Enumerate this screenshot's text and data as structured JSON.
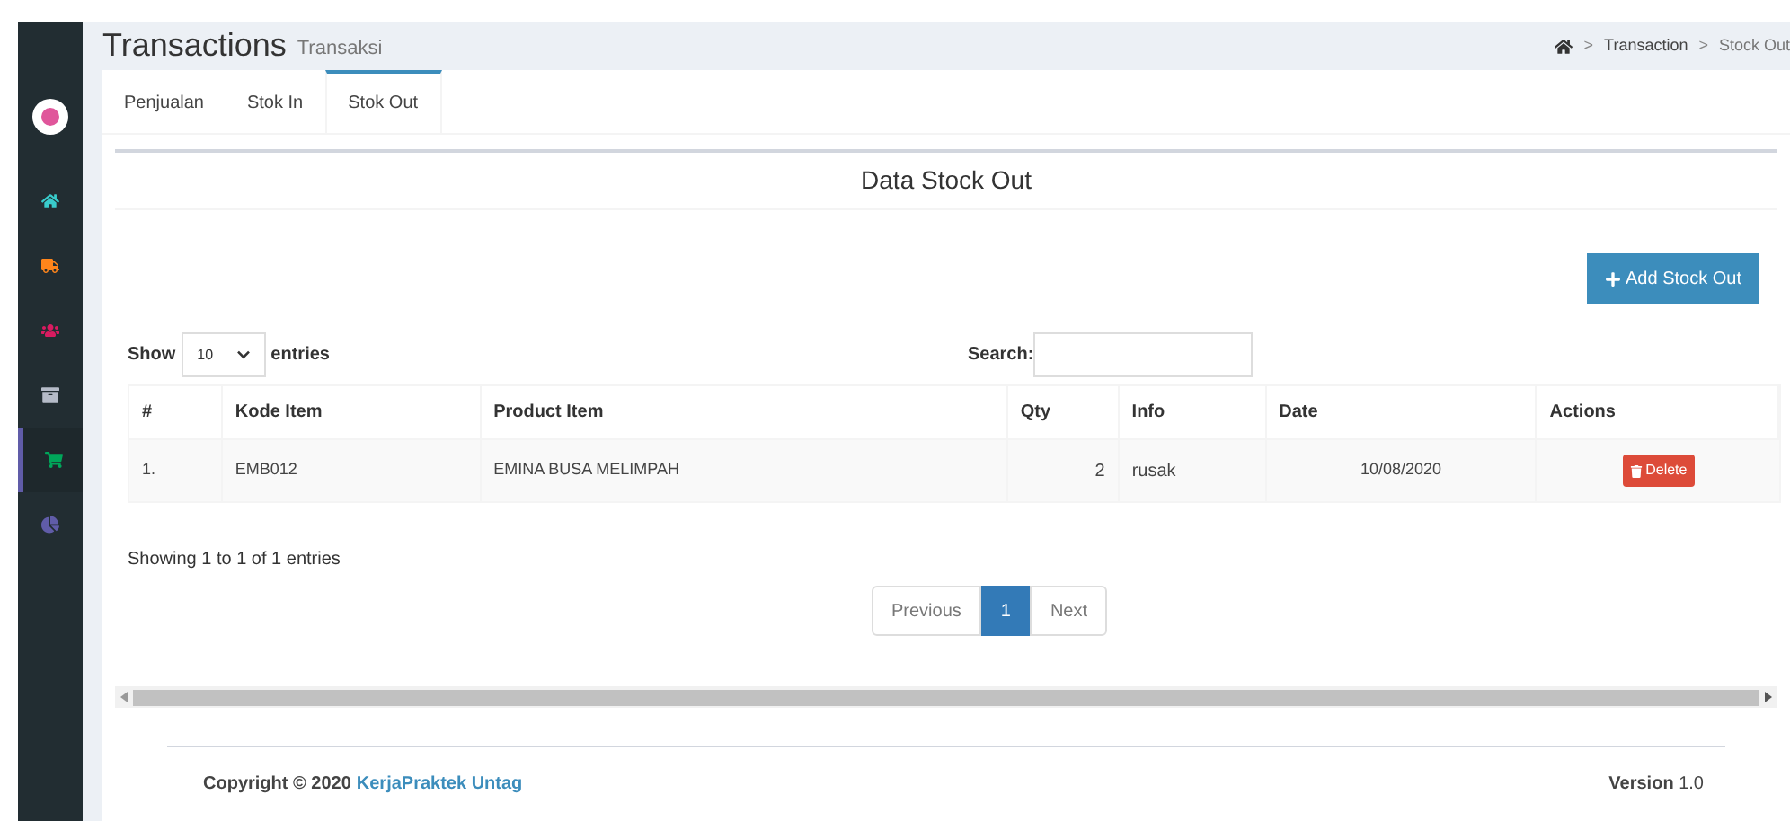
{
  "sidebar": {
    "items": [
      {
        "kind": "home",
        "color": "#39cccc",
        "selected": false
      },
      {
        "kind": "truck",
        "color": "#ff851b",
        "selected": false
      },
      {
        "kind": "users",
        "color": "#d81b60",
        "selected": false
      },
      {
        "kind": "archive",
        "color": "#b5bbc8",
        "selected": false
      },
      {
        "kind": "cart",
        "color": "#00a65a",
        "selected": true
      },
      {
        "kind": "chart",
        "color": "#605ca8",
        "selected": false
      }
    ]
  },
  "header": {
    "title": "Transactions",
    "subtitle": "Transaksi",
    "breadcrumb": [
      "Transaction",
      "Stock Out"
    ],
    "separator": ">"
  },
  "tabs": [
    {
      "label": "Penjualan",
      "selected": false
    },
    {
      "label": "Stok In",
      "selected": false
    },
    {
      "label": "Stok Out",
      "selected": true
    }
  ],
  "panel": {
    "title": "Data Stock Out",
    "add_button": "Add Stock Out",
    "length": {
      "before": "Show",
      "value": "10",
      "after": "entries"
    },
    "search": {
      "label": "Search:"
    },
    "table": {
      "columns": [
        "#",
        "Kode Item",
        "Product Item",
        "Qty",
        "Info",
        "Date",
        "Actions"
      ],
      "rows": [
        {
          "no": "1.",
          "kode": "EMB012",
          "product": "EMINA BUSA MELIMPAH",
          "qty": "2",
          "info": "rusak",
          "date": "10/08/2020",
          "action": "Delete"
        }
      ]
    },
    "info": "Showing 1 to 1 of 1 entries",
    "pagination": [
      {
        "label": "Previous",
        "selected": false
      },
      {
        "label": "1",
        "selected": true
      },
      {
        "label": "Next",
        "selected": false
      }
    ]
  },
  "footer": {
    "copyright": "Copyright © 2020",
    "link": "KerjaPraktek Untag",
    "version": "**Version** 1.0"
  }
}
